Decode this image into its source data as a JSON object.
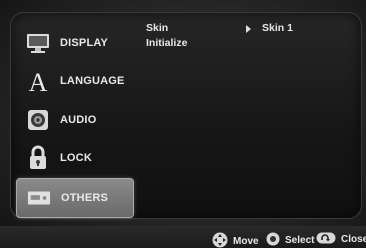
{
  "sidebar": {
    "items": [
      {
        "label": "DISPLAY",
        "icon": "display-icon"
      },
      {
        "label": "LANGUAGE",
        "icon": "language-icon"
      },
      {
        "label": "AUDIO",
        "icon": "audio-icon"
      },
      {
        "label": "LOCK",
        "icon": "lock-icon"
      },
      {
        "label": "OTHERS",
        "icon": "others-icon",
        "selected": true
      }
    ]
  },
  "content": {
    "options": [
      {
        "label": "Skin",
        "value": "Skin 1"
      },
      {
        "label": "Initialize"
      }
    ]
  },
  "footer": {
    "hints": [
      {
        "label": "Move",
        "icon": "dpad-icon"
      },
      {
        "label": "Select",
        "icon": "select-button-icon"
      },
      {
        "label": "Close",
        "icon": "return-button-icon"
      }
    ]
  },
  "colors": {
    "selected_highlight": "#7a7a7a",
    "text": "#e8e8e8",
    "panel_background": "#161616"
  }
}
